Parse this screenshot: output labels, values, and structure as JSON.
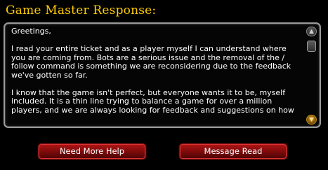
{
  "dialog": {
    "title": "Game Master Response:"
  },
  "message": {
    "paragraphs": [
      "Greetings,",
      "I read your entire ticket and as a player myself I can understand where\nyou are coming from. Bots are a serious issue and the removal of the /\nfollow command is something we are reconsidering due to the feedback\nwe've gotten so far.",
      "I know that the game isn't perfect, but everyone wants it to be, myself\nincluded. It is a thin line trying to balance a game for over a million\nplayers, and we are always looking for feedback and suggestions on how"
    ]
  },
  "scrollbar": {
    "up_icon": "chevron-up-icon",
    "down_icon": "chevron-down-icon"
  },
  "buttons": {
    "need_help": "Need More Help",
    "message_read": "Message Read"
  }
}
